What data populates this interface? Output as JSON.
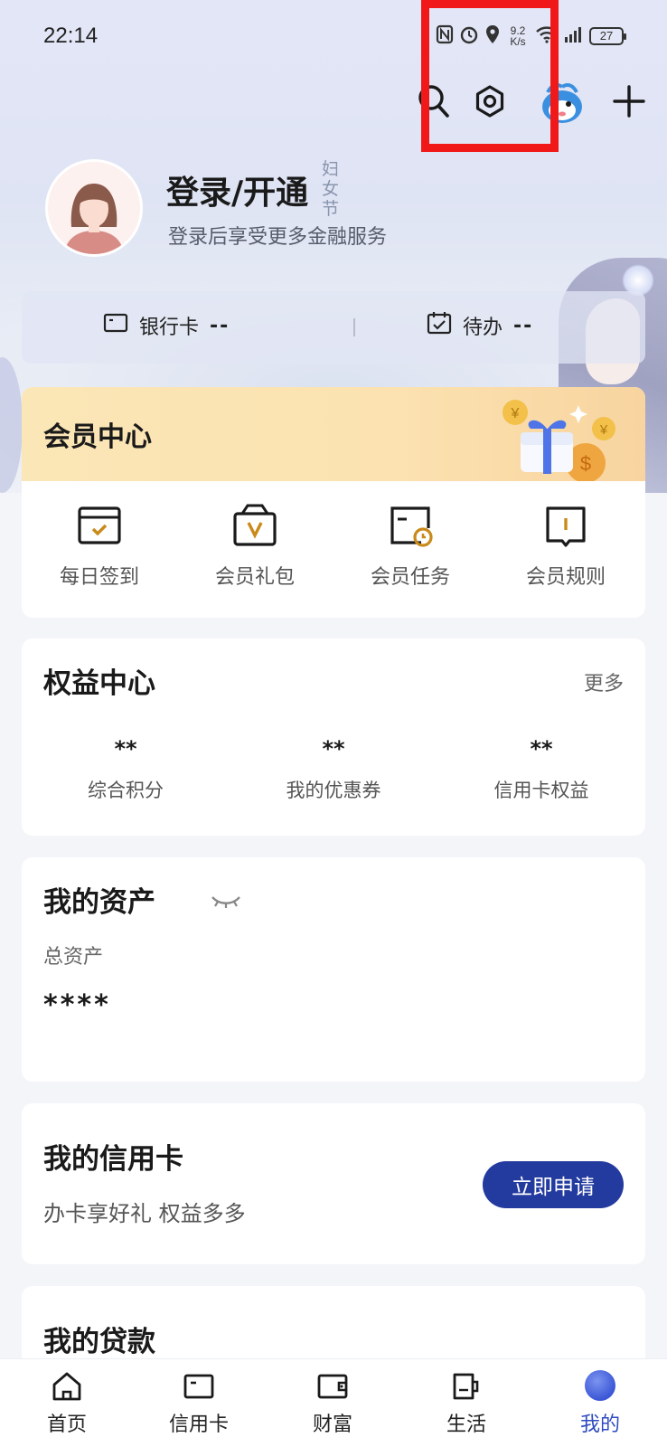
{
  "status_bar": {
    "time": "22:14",
    "net_speed_value": "9.2",
    "net_speed_unit": "K/s",
    "battery": "27"
  },
  "topbar": {
    "icons": [
      "search-icon",
      "settings-icon",
      "mascot-icon",
      "add-icon"
    ]
  },
  "profile": {
    "title": "登录/开通",
    "subtitle": "登录后享受更多金融服务",
    "festival_tag": "妇女节"
  },
  "bank_strip": {
    "bank_card_label": "银行卡",
    "bank_card_value": "--",
    "todo_label": "待办",
    "todo_value": "--"
  },
  "member_center": {
    "title": "会员中心",
    "items": [
      {
        "label": "每日签到",
        "icon": "calendar-check-icon"
      },
      {
        "label": "会员礼包",
        "icon": "gift-bag-icon"
      },
      {
        "label": "会员任务",
        "icon": "task-clock-icon"
      },
      {
        "label": "会员规则",
        "icon": "rules-book-icon"
      }
    ]
  },
  "rights_center": {
    "title": "权益中心",
    "more": "更多",
    "stats": [
      {
        "value": "**",
        "label": "综合积分"
      },
      {
        "value": "**",
        "label": "我的优惠券"
      },
      {
        "value": "**",
        "label": "信用卡权益"
      }
    ]
  },
  "assets": {
    "title": "我的资产",
    "total_label": "总资产",
    "total_value": "****"
  },
  "credit_card": {
    "title": "我的信用卡",
    "subtitle": "办卡享好礼 权益多多",
    "apply_button": "立即申请"
  },
  "loans": {
    "title": "我的贷款"
  },
  "bottom_nav": {
    "items": [
      {
        "label": "首页",
        "icon": "home-icon"
      },
      {
        "label": "信用卡",
        "icon": "credit-card-icon"
      },
      {
        "label": "财富",
        "icon": "wallet-icon"
      },
      {
        "label": "生活",
        "icon": "cup-icon"
      },
      {
        "label": "我的",
        "icon": "profile-icon"
      }
    ],
    "active": "我的"
  },
  "colors": {
    "accent": "#233a9f",
    "highlight_border": "#f01818",
    "member_gold": "#c98a1a"
  }
}
